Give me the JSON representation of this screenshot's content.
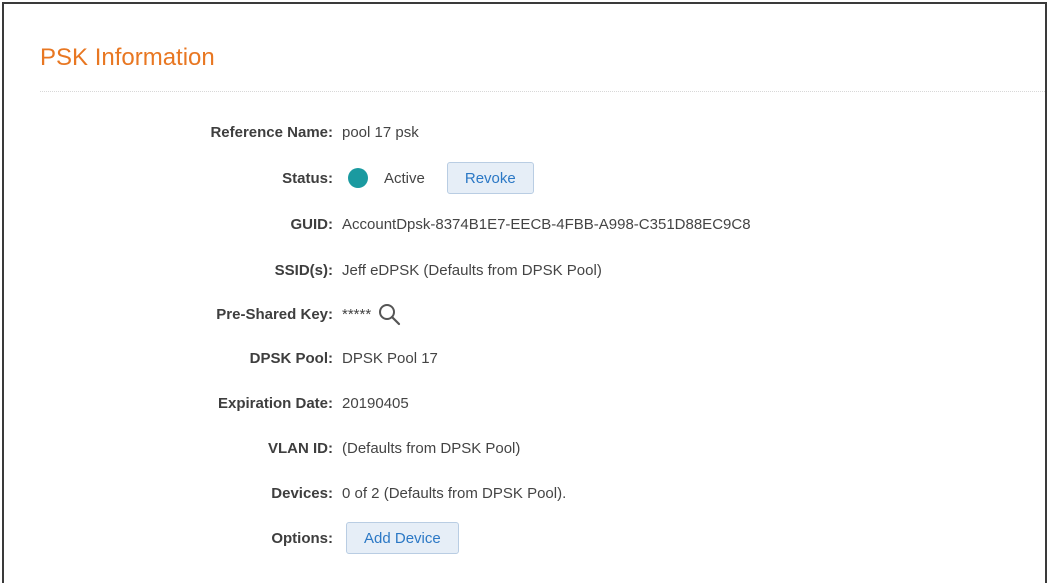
{
  "header": {
    "title": "PSK Information"
  },
  "colors": {
    "accent": "#e87722",
    "status_active": "#1a9aa0",
    "button_text": "#2b78c5"
  },
  "fields": {
    "reference_name": {
      "label": "Reference Name:",
      "value": "pool 17 psk"
    },
    "status": {
      "label": "Status:",
      "value": "Active",
      "action": "Revoke"
    },
    "guid": {
      "label": "GUID:",
      "value": "AccountDpsk-8374B1E7-EECB-4FBB-A998-C351D88EC9C8"
    },
    "ssids": {
      "label": "SSID(s):",
      "value": "Jeff eDPSK (Defaults from DPSK Pool)"
    },
    "psk": {
      "label": "Pre-Shared Key:",
      "value": "*****",
      "icon": "search-icon"
    },
    "dpsk_pool": {
      "label": "DPSK Pool:",
      "value": "DPSK Pool 17"
    },
    "expiration": {
      "label": "Expiration Date:",
      "value": "20190405"
    },
    "vlan": {
      "label": "VLAN ID:",
      "value": "(Defaults from DPSK Pool)"
    },
    "devices": {
      "label": "Devices:",
      "value": "0 of 2 (Defaults from DPSK Pool)."
    },
    "options": {
      "label": "Options:",
      "action": "Add Device"
    }
  }
}
